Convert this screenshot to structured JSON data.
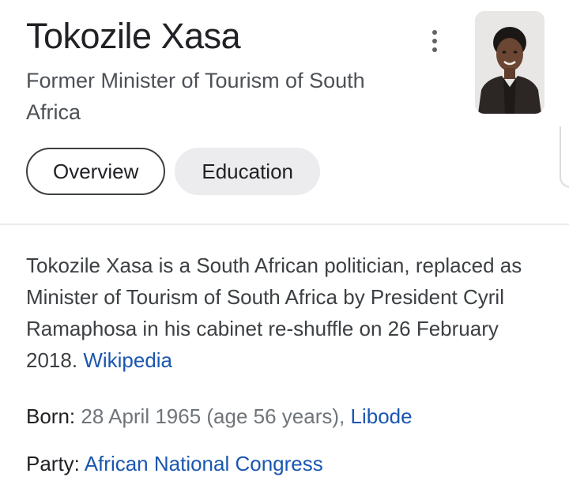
{
  "header": {
    "title": "Tokozile Xasa",
    "subtitle": "Former Minister of Tourism of South Africa"
  },
  "icons": {
    "more": "more-vert-icon",
    "photo": "person-photo"
  },
  "tabs": [
    {
      "label": "Overview",
      "active": true
    },
    {
      "label": "Education",
      "active": false
    }
  ],
  "description": {
    "text": "Tokozile Xasa is a South African politician, replaced as Minister of Tourism of South Africa by President Cyril Ramaphosa in his cabinet re-shuffle on 26 February 2018.",
    "source_link": "Wikipedia"
  },
  "facts": {
    "born": {
      "label": "Born:",
      "value": "28 April 1965 (age 56 years),",
      "link": "Libode"
    },
    "party": {
      "label": "Party:",
      "link": "African National Congress"
    }
  },
  "colors": {
    "link": "#1a56b0",
    "text": "#202124",
    "secondary": "#70757a",
    "tab_inactive_bg": "#ececef"
  }
}
